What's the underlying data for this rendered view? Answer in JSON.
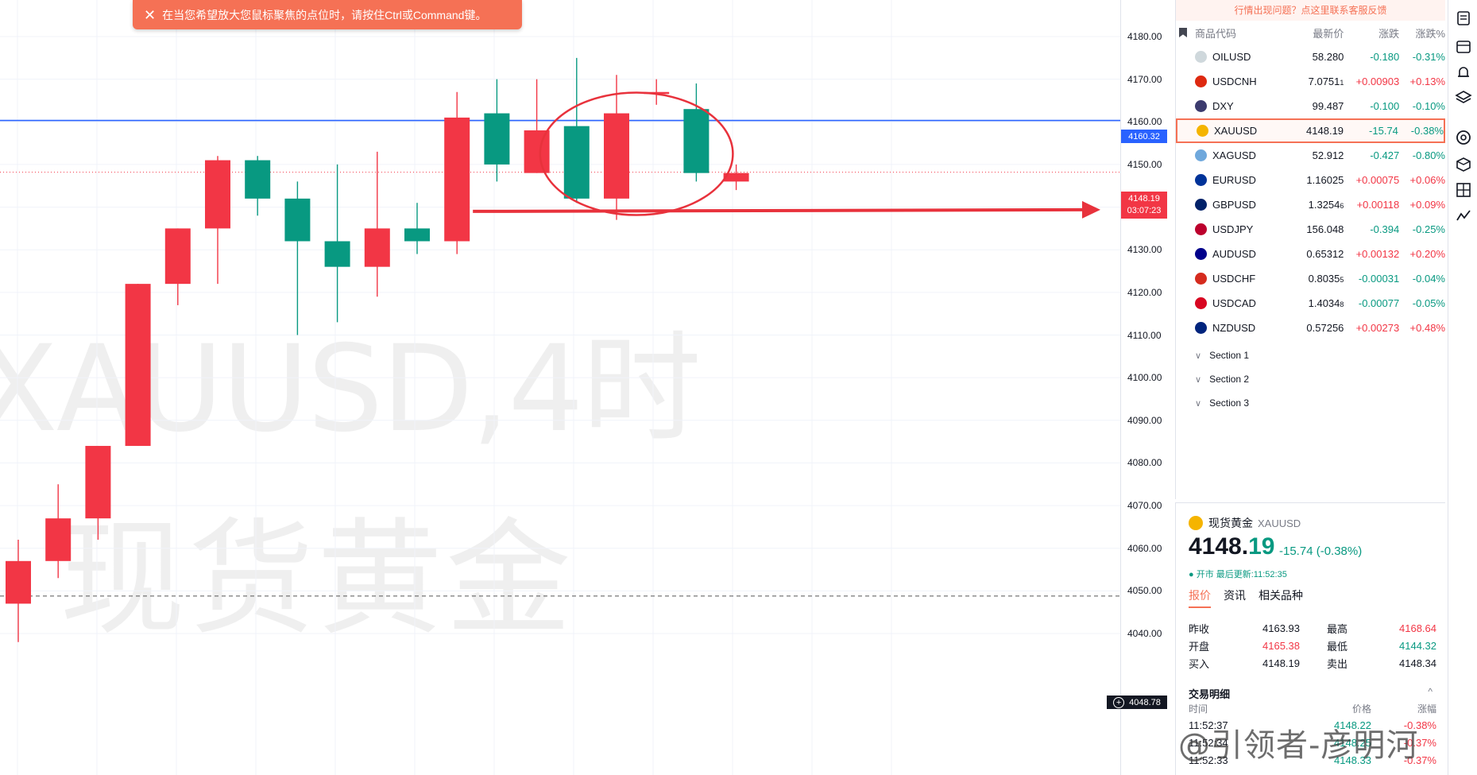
{
  "hint_toast": {
    "icon": "close-icon",
    "text": "在当您希望放大您鼠标聚焦的点位时，请按住Ctrl或Command键。"
  },
  "watermark": {
    "line1": "XAUUSD,4时",
    "line2": "现货黄金"
  },
  "price_axis": {
    "ticks": [
      "4180.00",
      "4170.00",
      "4160.00",
      "4150.00",
      "4140.00",
      "4130.00",
      "4120.00",
      "4110.00",
      "4100.00",
      "4090.00",
      "4080.00",
      "4070.00",
      "4060.00",
      "4050.00",
      "4040.00"
    ],
    "tag_blue": "4160.32",
    "tag_current": "4148.19",
    "tag_countdown": "03:07:23",
    "tag_crosshair": "4048.78"
  },
  "chart_data": {
    "type": "candlestick",
    "symbol": "XAUUSD",
    "interval": "4时",
    "ylim": [
      4030,
      4188
    ],
    "colors": {
      "up": "#f23645",
      "down": "#089981",
      "blue_line": "#2962ff",
      "annotation": "#e8323c"
    },
    "candles": [
      {
        "o": 4047,
        "h": 4062,
        "l": 4038,
        "c": 4057
      },
      {
        "o": 4057,
        "h": 4075,
        "l": 4053,
        "c": 4067
      },
      {
        "o": 4067,
        "h": 4084,
        "l": 4062,
        "c": 4084
      },
      {
        "o": 4084,
        "h": 4122,
        "l": 4084,
        "c": 4122
      },
      {
        "o": 4122,
        "h": 4131,
        "l": 4117,
        "c": 4135
      },
      {
        "o": 4135,
        "h": 4152,
        "l": 4122,
        "c": 4151
      },
      {
        "o": 4151,
        "h": 4152,
        "l": 4138,
        "c": 4142
      },
      {
        "o": 4142,
        "h": 4146,
        "l": 4110,
        "c": 4132
      },
      {
        "o": 4132,
        "h": 4150,
        "l": 4113,
        "c": 4126
      },
      {
        "o": 4126,
        "h": 4153,
        "l": 4119,
        "c": 4135
      },
      {
        "o": 4135,
        "h": 4141,
        "l": 4129,
        "c": 4132
      },
      {
        "o": 4132,
        "h": 4167,
        "l": 4129,
        "c": 4161
      },
      {
        "o": 4162,
        "h": 4170,
        "l": 4146,
        "c": 4150
      },
      {
        "o": 4148,
        "h": 4170,
        "l": 4148,
        "c": 4158
      },
      {
        "o": 4159,
        "h": 4175,
        "l": 4141,
        "c": 4142
      },
      {
        "o": 4142,
        "h": 4171,
        "l": 4137,
        "c": 4162
      },
      {
        "o": 4167,
        "h": 4170,
        "l": 4164,
        "c": 4167
      },
      {
        "o": 4163,
        "h": 4169,
        "l": 4146,
        "c": 4148
      },
      {
        "o": 4146,
        "h": 4150,
        "l": 4144,
        "c": 4148
      }
    ],
    "horizontal_lines": [
      {
        "price": 4160.32,
        "color": "#2962ff"
      },
      {
        "price": 4148.19,
        "color": "#f23645",
        "style": "dotted"
      },
      {
        "price": 4048.78,
        "color": "#555555",
        "style": "dashed"
      }
    ],
    "annotations": {
      "circle_candles": [
        14,
        17
      ],
      "arrow_price": 4139,
      "arrow_from_candle": 11
    }
  },
  "watchlist": {
    "feedback": "行情出现问题？点这里联系客服反馈",
    "headers": {
      "symbol": "商品代码",
      "last": "最新价",
      "change": "涨跌",
      "change_pct": "涨跌%"
    },
    "rows": [
      {
        "sym": "OILUSD",
        "last": "58.280",
        "chg": "-0.180",
        "pct": "-0.31%",
        "dir": "down",
        "flag": "#cfd8dc",
        "icon": "oil-icon"
      },
      {
        "sym": "USDCNH",
        "last": "7.0751",
        "last_small": "1",
        "chg": "+0.00903",
        "pct": "+0.13%",
        "dir": "up",
        "flag": "#de2910",
        "icon": "flag-us-cn-icon"
      },
      {
        "sym": "DXY",
        "last": "99.487",
        "chg": "-0.100",
        "pct": "-0.10%",
        "dir": "down",
        "flag": "#3c3b6e",
        "icon": "flag-us-icon"
      },
      {
        "sym": "XAUUSD",
        "last": "4148.19",
        "last_small": "",
        "chg": "-15.74",
        "pct": "-0.38%",
        "dir": "down",
        "flag": "#f5b400",
        "icon": "gold-icon",
        "active": true
      },
      {
        "sym": "XAGUSD",
        "last": "52.912",
        "chg": "-0.427",
        "pct": "-0.80%",
        "dir": "down",
        "flag": "#6fa8dc",
        "icon": "silver-icon"
      },
      {
        "sym": "EURUSD",
        "last": "1.16025",
        "chg": "+0.00075",
        "pct": "+0.06%",
        "dir": "up",
        "flag": "#003399",
        "icon": "flag-eu-us-icon"
      },
      {
        "sym": "GBPUSD",
        "last": "1.3254",
        "last_small": "6",
        "chg": "+0.00118",
        "pct": "+0.09%",
        "dir": "up",
        "flag": "#012169",
        "icon": "flag-gb-us-icon"
      },
      {
        "sym": "USDJPY",
        "last": "156.048",
        "chg": "-0.394",
        "pct": "-0.25%",
        "dir": "down",
        "flag": "#bc002d",
        "icon": "flag-us-jp-icon"
      },
      {
        "sym": "AUDUSD",
        "last": "0.65312",
        "chg": "+0.00132",
        "pct": "+0.20%",
        "dir": "up",
        "flag": "#00008b",
        "icon": "flag-au-us-icon"
      },
      {
        "sym": "USDCHF",
        "last": "0.8035",
        "last_small": "5",
        "chg": "-0.00031",
        "pct": "-0.04%",
        "dir": "down",
        "flag": "#d52b1e",
        "icon": "flag-us-ch-icon"
      },
      {
        "sym": "USDCAD",
        "last": "1.4034",
        "last_small": "8",
        "chg": "-0.00077",
        "pct": "-0.05%",
        "dir": "down",
        "flag": "#d80621",
        "icon": "flag-us-ca-icon"
      },
      {
        "sym": "NZDUSD",
        "last": "0.57256",
        "chg": "+0.00273",
        "pct": "+0.48%",
        "dir": "up",
        "flag": "#00247d",
        "icon": "flag-nz-us-icon"
      }
    ],
    "sections": [
      "Section 1",
      "Section 2",
      "Section 3"
    ]
  },
  "details": {
    "name": "现货黄金",
    "symbol": "XAUUSD",
    "price_int": "4148.",
    "price_dec": "19",
    "change": "-15.74 (-0.38%)",
    "status": "● 开市 最后更新:11:52:35",
    "tabs": [
      "报价",
      "资讯",
      "相关品种"
    ],
    "stats": [
      {
        "k": "昨收",
        "v": "4163.93",
        "vcolor": "#131722",
        "k2": "最高",
        "v2": "4168.64",
        "v2color": "#f23645"
      },
      {
        "k": "开盘",
        "v": "4165.38",
        "vcolor": "#f23645",
        "k2": "最低",
        "v2": "4144.32",
        "v2color": "#089981"
      },
      {
        "k": "买入",
        "v": "4148.19",
        "vcolor": "#131722",
        "k2": "卖出",
        "v2": "4148.34",
        "v2color": "#131722"
      }
    ],
    "trades_title": "交易明细",
    "trades_collapse": "^",
    "trades_headers": {
      "time": "时间",
      "price": "价格",
      "chg": "涨幅"
    },
    "trades": [
      {
        "t": "11:52:37",
        "p": "4148.22",
        "c": "-0.38%"
      },
      {
        "t": "11:52:34",
        "p": "4148.25",
        "c": "-0.37%"
      },
      {
        "t": "11:52:33",
        "p": "4148.33",
        "c": "-0.37%"
      }
    ]
  },
  "overlay_mark": "@引领者-彦明河",
  "toolbar": [
    "news-icon",
    "calendar-icon",
    "alert-bell-icon",
    "layers-icon",
    "ideas-icon",
    "cube-icon",
    "grid-icon",
    "chart-icon"
  ]
}
